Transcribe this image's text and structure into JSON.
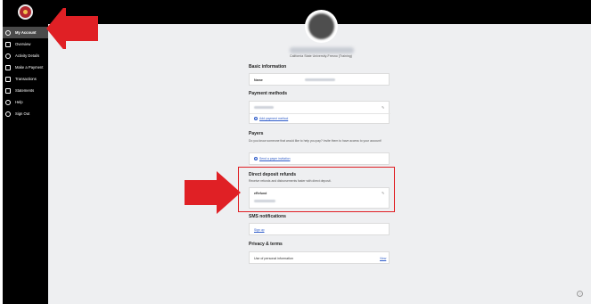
{
  "sidebar": {
    "items": [
      {
        "label": "My Account",
        "icon": "user-icon",
        "active": true
      },
      {
        "label": "Overview",
        "icon": "overview-icon",
        "active": false
      },
      {
        "label": "Activity Details",
        "icon": "clock-icon",
        "active": false
      },
      {
        "label": "Make a Payment",
        "icon": "payment-icon",
        "active": false
      },
      {
        "label": "Transactions",
        "icon": "transactions-icon",
        "active": false
      },
      {
        "label": "Statements",
        "icon": "statements-icon",
        "active": false
      },
      {
        "label": "Help",
        "icon": "help-icon",
        "active": false
      },
      {
        "label": "Sign Out",
        "icon": "sign-out-icon",
        "active": false
      }
    ]
  },
  "profile": {
    "school": "California State University-Fresno (Training)"
  },
  "basic_info": {
    "title": "Basic information",
    "name_label": "Name"
  },
  "payment_methods": {
    "title": "Payment methods",
    "add_link": "Add payment method"
  },
  "payers": {
    "title": "Payers",
    "description": "Do you know someone that would like to help you pay? Invite them to have access to your account!",
    "invite_link": "Send a payer invitation"
  },
  "direct_deposit": {
    "title": "Direct deposit refunds",
    "description": "Receive refunds and disbursements faster with direct deposit.",
    "method_label": "eRefund"
  },
  "sms": {
    "title": "SMS notifications",
    "signup_link": "Sign up"
  },
  "privacy": {
    "title": "Privacy & terms",
    "item_label": "Use of personal information",
    "view_link": "View"
  },
  "colors": {
    "annotation_red": "#e02025",
    "link_blue": "#2f5cc9",
    "sidebar_bg": "#000000",
    "content_bg": "#eeeff1"
  }
}
